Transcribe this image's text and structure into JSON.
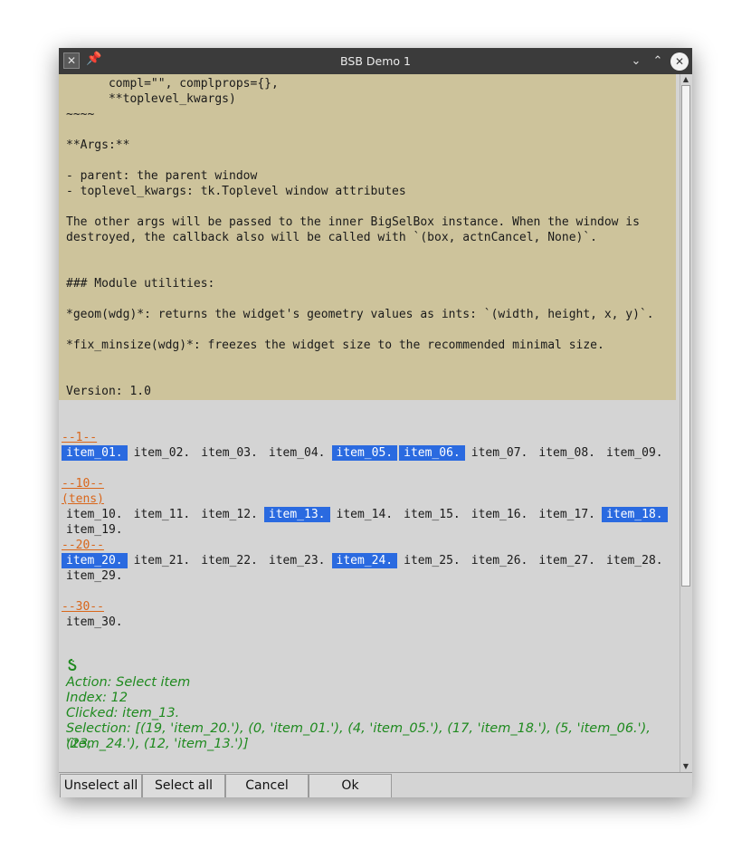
{
  "window": {
    "title": "BSB Demo 1"
  },
  "doc_lines": [
    "      compl=\"\", complprops={},",
    "      **toplevel_kwargs)",
    "~~~~",
    "",
    "**Args:**",
    "",
    "- parent: the parent window",
    "- toplevel_kwargs: tk.Toplevel window attributes",
    "",
    "The other args will be passed to the inner BigSelBox instance. When the window is",
    "destroyed, the callback also will be called with `(box, actnCancel, None)`.",
    "",
    "",
    "### Module utilities:",
    "",
    "*geom(wdg)*: returns the widget's geometry values as ints: `(width, height, x, y)`.",
    "",
    "*fix_minsize(wdg)*: freezes the widget size to the recommended minimal size.",
    "",
    "",
    "Version: 1.0"
  ],
  "sections": [
    {
      "header": "--1--",
      "sub": "",
      "items": [
        {
          "label": "item_01.",
          "selected": true
        },
        {
          "label": "item_02.",
          "selected": false
        },
        {
          "label": "item_03.",
          "selected": false
        },
        {
          "label": "item_04.",
          "selected": false
        },
        {
          "label": "item_05.",
          "selected": true
        },
        {
          "label": "item_06.",
          "selected": true
        },
        {
          "label": "item_07.",
          "selected": false
        },
        {
          "label": "item_08.",
          "selected": false
        },
        {
          "label": "item_09.",
          "selected": false
        }
      ]
    },
    {
      "header": "--10--",
      "sub": "(tens)",
      "items": [
        {
          "label": "item_10.",
          "selected": false
        },
        {
          "label": "item_11.",
          "selected": false
        },
        {
          "label": "item_12.",
          "selected": false
        },
        {
          "label": "item_13.",
          "selected": true
        },
        {
          "label": "item_14.",
          "selected": false
        },
        {
          "label": "item_15.",
          "selected": false
        },
        {
          "label": "item_16.",
          "selected": false
        },
        {
          "label": "item_17.",
          "selected": false
        },
        {
          "label": "item_18.",
          "selected": true
        },
        {
          "label": "item_19.",
          "selected": false
        }
      ]
    },
    {
      "header": "--20--",
      "sub": "",
      "items": [
        {
          "label": "item_20.",
          "selected": true
        },
        {
          "label": "item_21.",
          "selected": false
        },
        {
          "label": "item_22.",
          "selected": false
        },
        {
          "label": "item_23.",
          "selected": false
        },
        {
          "label": "item_24.",
          "selected": true
        },
        {
          "label": "item_25.",
          "selected": false
        },
        {
          "label": "item_26.",
          "selected": false
        },
        {
          "label": "item_27.",
          "selected": false
        },
        {
          "label": "item_28.",
          "selected": false
        },
        {
          "label": "item_29.",
          "selected": false
        }
      ]
    },
    {
      "header": "--30--",
      "sub": "",
      "items": [
        {
          "label": "item_30.",
          "selected": false
        }
      ]
    }
  ],
  "status": {
    "icon": "python-snake-icon",
    "action": "Action: Select item",
    "index": "Index: 12",
    "clicked": "Clicked: item_13.",
    "selection_line1": "Selection: [(19, 'item_20.'), (0, 'item_01.'), (4, 'item_05.'), (17, 'item_18.'), (5, 'item_06.'), (23,",
    "selection_line2": "'item_24.'), (12, 'item_13.')]"
  },
  "buttons": {
    "unselect_all": "Unselect all",
    "select_all": "Select all",
    "cancel": "Cancel",
    "ok": "Ok"
  },
  "colors": {
    "doc_background": "#cdc39b",
    "section_header": "#d9661a",
    "selection": "#2a6ae0",
    "status_text": "#1f8a1f"
  }
}
